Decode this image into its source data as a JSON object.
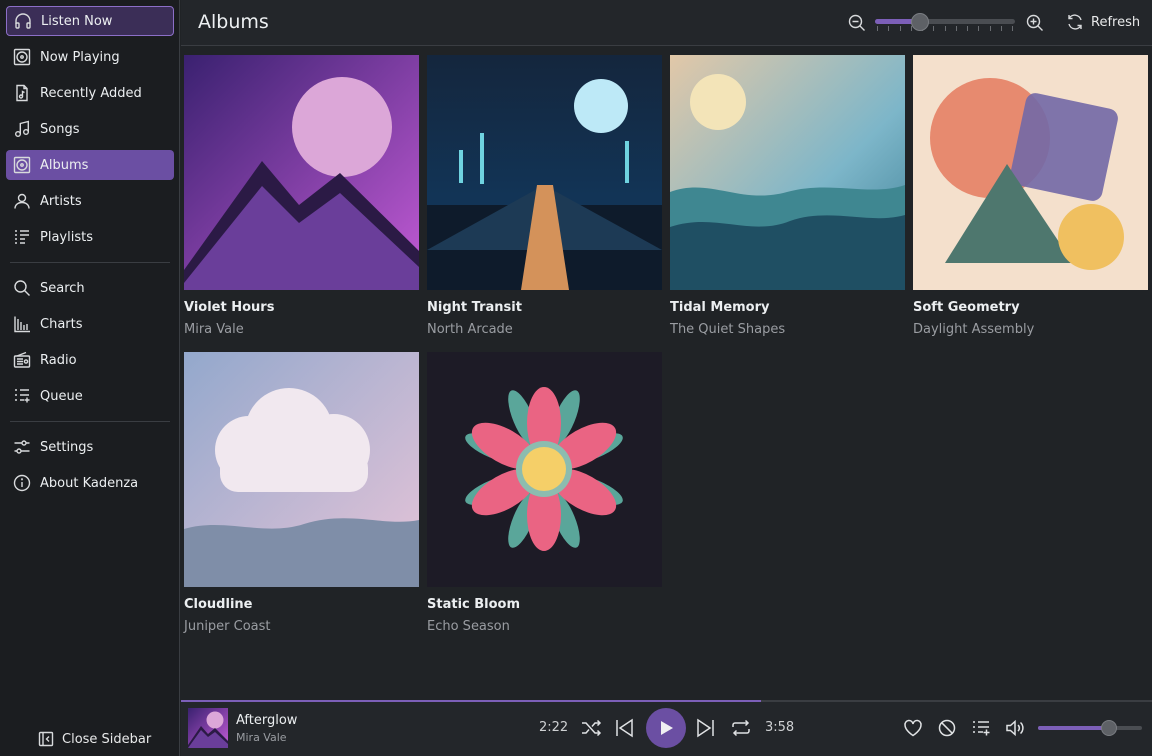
{
  "sidebar": {
    "items": [
      {
        "label": "Listen Now",
        "icon": "headphones-icon"
      },
      {
        "label": "Now Playing",
        "icon": "disc-icon"
      },
      {
        "label": "Recently Added",
        "icon": "document-music-icon"
      },
      {
        "label": "Songs",
        "icon": "music-note-icon"
      },
      {
        "label": "Albums",
        "icon": "album-icon"
      },
      {
        "label": "Artists",
        "icon": "person-icon"
      },
      {
        "label": "Playlists",
        "icon": "playlist-icon"
      },
      {
        "label": "Search",
        "icon": "search-icon"
      },
      {
        "label": "Charts",
        "icon": "chart-icon"
      },
      {
        "label": "Radio",
        "icon": "radio-icon"
      },
      {
        "label": "Queue",
        "icon": "queue-icon"
      },
      {
        "label": "Settings",
        "icon": "settings-icon"
      },
      {
        "label": "About Kadenza",
        "icon": "info-icon"
      }
    ],
    "close_label": "Close Sidebar"
  },
  "header": {
    "title": "Albums",
    "refresh_label": "Refresh",
    "zoom_level": 0.32
  },
  "albums": [
    {
      "title": "Violet Hours",
      "artist": "Mira Vale"
    },
    {
      "title": "Night Transit",
      "artist": "North Arcade"
    },
    {
      "title": "Tidal Memory",
      "artist": "The Quiet Shapes"
    },
    {
      "title": "Soft Geometry",
      "artist": "Daylight Assembly"
    },
    {
      "title": "Cloudline",
      "artist": "Juniper Coast"
    },
    {
      "title": "Static Bloom",
      "artist": "Echo Season"
    }
  ],
  "player": {
    "title": "Afterglow",
    "artist": "Mira Vale",
    "elapsed": "2:22",
    "duration": "3:58",
    "progress": 0.597,
    "volume": 0.68
  },
  "colors": {
    "accent": "#6b4fa3",
    "background": "#202326",
    "sidebar": "#1b1d20"
  }
}
